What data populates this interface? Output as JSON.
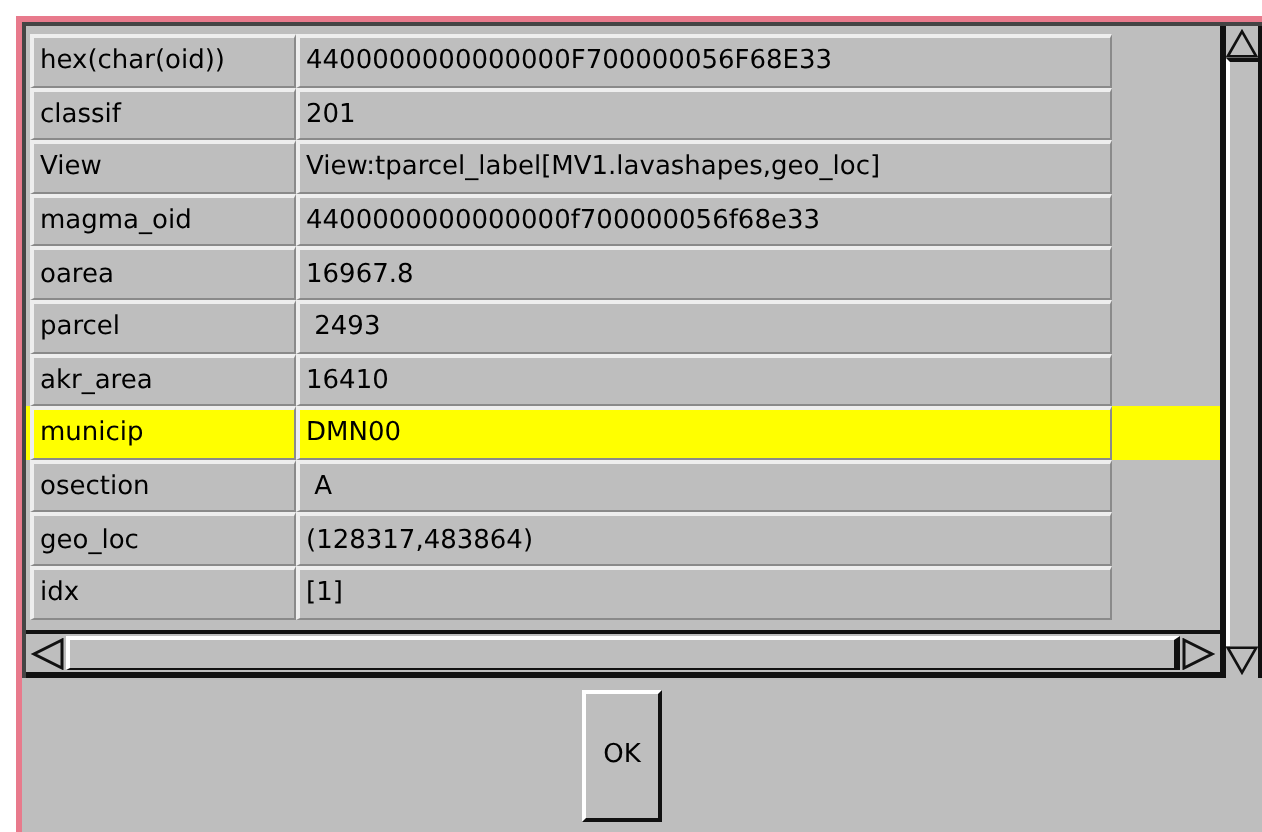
{
  "rows": [
    {
      "name": "hex(char(oid))",
      "value": "4400000000000000F700000056F68E33",
      "selected": false
    },
    {
      "name": "classif",
      "value": "201",
      "selected": false
    },
    {
      "name": "View",
      "value": "View:tparcel_label[MV1.lavashapes,geo_loc]",
      "selected": false
    },
    {
      "name": "magma_oid",
      "value": "4400000000000000f700000056f68e33",
      "selected": false
    },
    {
      "name": "oarea",
      "value": "16967.8",
      "selected": false
    },
    {
      "name": "parcel",
      "value": " 2493",
      "selected": false
    },
    {
      "name": "akr_area",
      "value": "16410",
      "selected": false
    },
    {
      "name": "municip",
      "value": "DMN00",
      "selected": true
    },
    {
      "name": "osection",
      "value": " A",
      "selected": false
    },
    {
      "name": "geo_loc",
      "value": "(128317,483864)",
      "selected": false
    },
    {
      "name": "idx",
      "value": "[1]",
      "selected": false
    }
  ],
  "buttons": [
    "OK"
  ]
}
